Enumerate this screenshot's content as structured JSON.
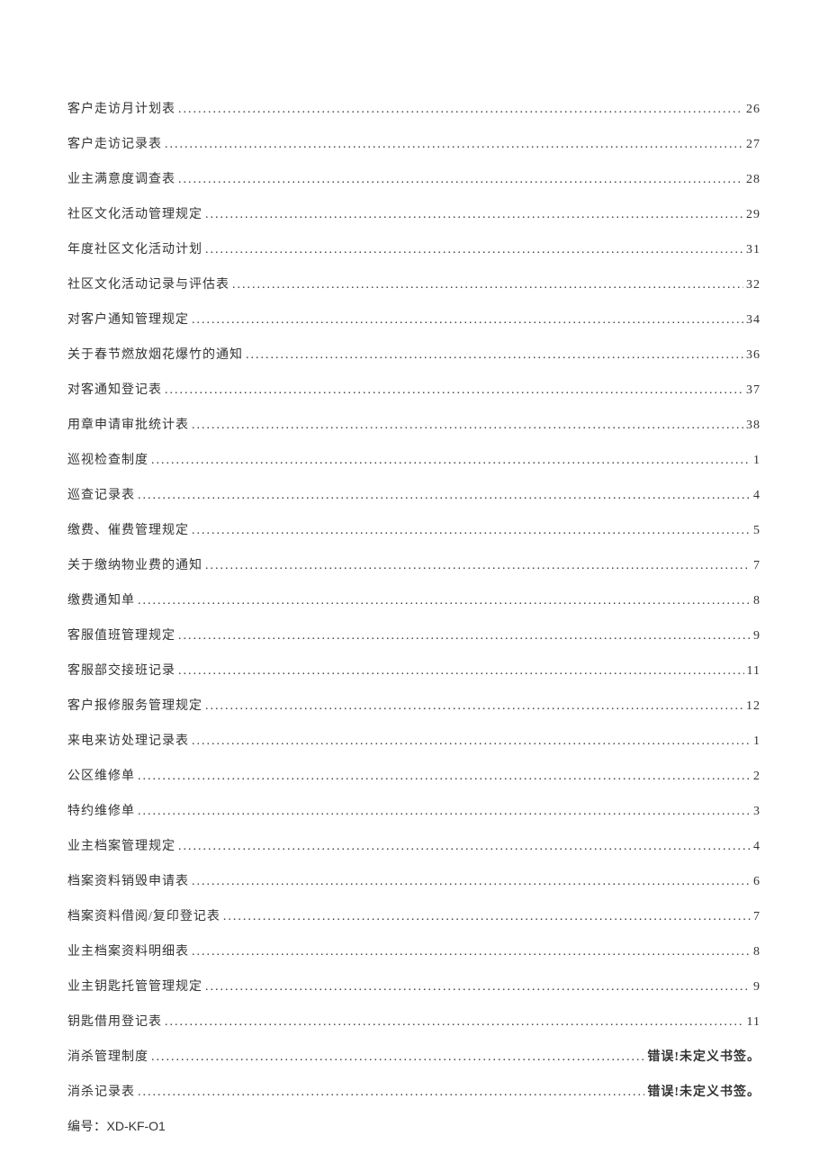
{
  "toc": [
    {
      "title": "客户走访月计划表",
      "page": "26"
    },
    {
      "title": "客户走访记录表",
      "page": "27"
    },
    {
      "title": "业主满意度调查表",
      "page": "28"
    },
    {
      "title": "社区文化活动管理规定",
      "page": "29"
    },
    {
      "title": "年度社区文化活动计划",
      "page": "31"
    },
    {
      "title": "社区文化活动记录与评估表",
      "page": "32"
    },
    {
      "title": "对客户通知管理规定",
      "page": "34"
    },
    {
      "title": "关于春节燃放烟花爆竹的通知",
      "page": "36"
    },
    {
      "title": "对客通知登记表",
      "page": "37"
    },
    {
      "title": "用章申请审批统计表",
      "page": "38"
    },
    {
      "title": "巡视检查制度",
      "page": "1"
    },
    {
      "title": "巡查记录表",
      "page": "4"
    },
    {
      "title": "缴费、催费管理规定",
      "page": "5"
    },
    {
      "title": "关于缴纳物业费的通知",
      "page": "7"
    },
    {
      "title": "缴费通知单",
      "page": "8"
    },
    {
      "title": "客服值班管理规定",
      "page": "9"
    },
    {
      "title": "客服部交接班记录",
      "page": "11"
    },
    {
      "title": "客户报修服务管理规定",
      "page": "12"
    },
    {
      "title": "来电来访处理记录表",
      "page": "1"
    },
    {
      "title": "公区维修单",
      "page": "2"
    },
    {
      "title": "特约维修单",
      "page": "3"
    },
    {
      "title": "业主档案管理规定",
      "page": "4"
    },
    {
      "title": "档案资料销毁申请表",
      "page": "6"
    },
    {
      "title": "档案资料借阅/复印登记表",
      "page": "7"
    },
    {
      "title": "业主档案资料明细表",
      "page": "8"
    },
    {
      "title": "业主钥匙托管管理规定",
      "page": "9"
    },
    {
      "title": "钥匙借用登记表",
      "page": "11"
    },
    {
      "title": "消杀管理制度",
      "page": "错误!未定义书签。",
      "error": true
    },
    {
      "title": "消杀记录表",
      "page": "错误!未定义书签。",
      "error": true
    }
  ],
  "docCode": {
    "label": "编号：",
    "value": "XD-KF-O1"
  }
}
